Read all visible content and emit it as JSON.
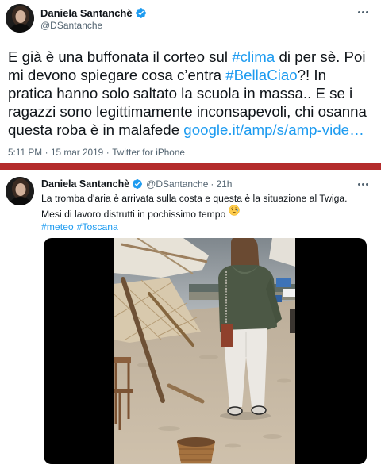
{
  "theme": {
    "text_color": "#0f1419",
    "muted_color": "#536471",
    "link_color": "#1d9bf0",
    "verified_color": "#1d9bf0",
    "divider_color": "#b42c2c",
    "background": "#ffffff"
  },
  "icons": {
    "verified": "verified-badge-icon",
    "more": "more-options-icon",
    "emoji": "sad-but-relieved-face-icon"
  },
  "main_tweet": {
    "author_name": "Daniela Santanchè",
    "handle": "@DSantanche",
    "lines": [
      [
        "E già è una buffonata il corteo sul ",
        "#clima",
        " di per sè. Poi"
      ],
      [
        "mi devono spiegare cosa c’entra ",
        "#BellaCiao",
        "?! In"
      ],
      [
        "pratica hanno solo saltato la scuola in massa.. E se i"
      ],
      [
        "ragazzi sono legittimamente inconsapevoli, chi osanna"
      ],
      [
        "questa roba è in malafede ",
        "google.it/amp/s/amp-vide…"
      ]
    ],
    "time": "5:11 PM",
    "date": "15 mar 2019",
    "source": "Twitter for iPhone",
    "separator": "·"
  },
  "second_tweet": {
    "author_name": "Daniela Santanchè",
    "handle": "@DSantanche",
    "separator": "·",
    "time_ago": "21h",
    "lines": [
      "La tromba d'aria è arrivata sulla costa e questa è la situazione al Twiga.",
      "Mesi di lavoro distrutti in pochissimo tempo"
    ],
    "hashtags": [
      "#meteo",
      "#Toscana"
    ]
  }
}
